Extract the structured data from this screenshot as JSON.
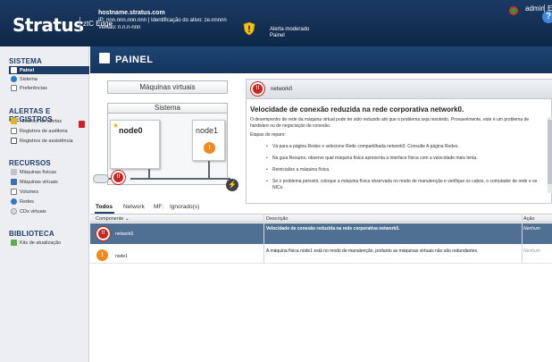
{
  "header": {
    "logo_text": "Stratus",
    "logo_product": "ztC Edge",
    "host_name": "hostname.stratus.com",
    "host_ip_line": "IP: nnn.nnn.nnn.nnn | Identificação do ativo: ze-nnnnn",
    "version_line": "Versão: n.n.n-nnn",
    "alert_level": "Alerta moderado",
    "alert_target": "Painel",
    "user_name": "admin",
    "user_extra": "E"
  },
  "sidebar": {
    "sections": [
      {
        "title": "SISTEMA",
        "items": [
          {
            "label": "Painel",
            "icon": "dashboard-icon",
            "active": true
          },
          {
            "label": "Sistema",
            "icon": "system-icon"
          },
          {
            "label": "Preferências",
            "icon": "preferences-icon"
          }
        ]
      },
      {
        "title": "ALERTAS E REGISTROS",
        "items": [
          {
            "label": "Histórico de alertas",
            "icon": "alert-history-icon"
          },
          {
            "label": "Registros de auditoria",
            "icon": "audit-log-icon"
          },
          {
            "label": "Registros de assistência",
            "icon": "support-log-icon"
          }
        ]
      },
      {
        "title": "RECURSOS",
        "items": [
          {
            "label": "Máquinas físicas",
            "icon": "physical-machine-icon"
          },
          {
            "label": "Máquinas virtuais",
            "icon": "virtual-machine-icon"
          },
          {
            "label": "Volumes",
            "icon": "volumes-icon"
          },
          {
            "label": "Redes",
            "icon": "networks-icon"
          },
          {
            "label": "CDs virtuais",
            "icon": "virtual-cd-icon"
          }
        ]
      },
      {
        "title": "BIBLIOTECA",
        "items": [
          {
            "label": "Kits de atualização",
            "icon": "upgrade-kit-icon"
          }
        ]
      }
    ]
  },
  "page": {
    "title": "PAINEL",
    "help": "?"
  },
  "topology": {
    "vm_label": "Máquinas virtuais",
    "system_label": "Sistema",
    "node0_label": "node0",
    "node1_label": "node1"
  },
  "alert_panel": {
    "header_label": "network0",
    "title": "Velocidade de conexão reduzida na rede corporativa network0.",
    "body": "O desempenho de rede da máquina virtual pode ter sido reduzido até que o problema seja resolvido. Provavelmente, este é um problema de hardware ou de negociação de conexão.",
    "steps_title": "Etapas do reparo:",
    "steps": [
      "Vá para a página Redes e selecione Rede compartilhada network0. Consulte A página Redes.",
      "Na guia Resumo, observe qual máquina física apresenta a interface física com a velocidade mais lenta.",
      "Reinicialize a máquina física.",
      "Se o problema persistir, coloque a máquina física observada no modo de manutenção e verifique os cabos, o comutador de rede e os NICs."
    ]
  },
  "tabs": [
    "Todos",
    "Network",
    "MF:",
    "Ignorado(s)"
  ],
  "table": {
    "columns": {
      "component": "Componente",
      "description": "Descrição",
      "action": "Ação"
    },
    "rows": [
      {
        "component": "network0",
        "description": "Velocidade de conexão reduzida na rede corporativa network0.",
        "action": "Nenhum",
        "status": "error"
      },
      {
        "component": "node1",
        "description": "A máquina física node1 está no modo de manutenção, portanto as máquinas virtuais não são redundantes.",
        "action": "Nenhum",
        "status": "warning"
      }
    ]
  },
  "colors": {
    "header": "#14345c",
    "accent": "#1f4473",
    "selected_row": "#4f6f93",
    "error": "#c9241c",
    "warning": "#f08a1c"
  }
}
